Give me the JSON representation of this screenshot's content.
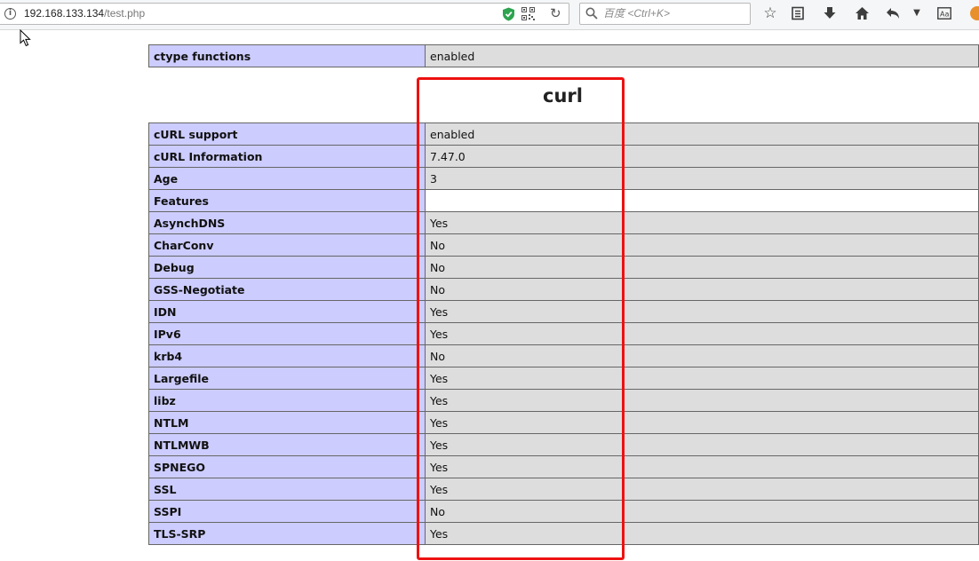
{
  "browser": {
    "url_host": "192.168.133.134",
    "url_path": "/test.php",
    "search_placeholder": "百度 <Ctrl+K>",
    "icons": [
      "info-icon",
      "shield-icon",
      "qr-code-icon",
      "reload-icon",
      "search-icon",
      "bookmark-star-icon",
      "reader-list-icon",
      "download-icon",
      "home-icon",
      "back-icon",
      "menu-dropdown-icon",
      "reader-mode-icon",
      "avatar-icon"
    ]
  },
  "ctype": {
    "label": "ctype functions",
    "value": "enabled"
  },
  "curl": {
    "title": "curl",
    "rows": [
      {
        "label": "cURL support",
        "value": "enabled"
      },
      {
        "label": "cURL Information",
        "value": "7.47.0"
      },
      {
        "label": "Age",
        "value": "3"
      },
      {
        "label": "Features",
        "value": ""
      },
      {
        "label": "AsynchDNS",
        "value": "Yes"
      },
      {
        "label": "CharConv",
        "value": "No"
      },
      {
        "label": "Debug",
        "value": "No"
      },
      {
        "label": "GSS-Negotiate",
        "value": "No"
      },
      {
        "label": "IDN",
        "value": "Yes"
      },
      {
        "label": "IPv6",
        "value": "Yes"
      },
      {
        "label": "krb4",
        "value": "No"
      },
      {
        "label": "Largefile",
        "value": "Yes"
      },
      {
        "label": "libz",
        "value": "Yes"
      },
      {
        "label": "NTLM",
        "value": "Yes"
      },
      {
        "label": "NTLMWB",
        "value": "Yes"
      },
      {
        "label": "SPNEGO",
        "value": "Yes"
      },
      {
        "label": "SSL",
        "value": "Yes"
      },
      {
        "label": "SSPI",
        "value": "No"
      },
      {
        "label": "TLS-SRP",
        "value": "Yes"
      }
    ]
  },
  "colors": {
    "label_cell": "#ccccff",
    "value_cell": "#dddddd",
    "highlight": "#ee1111"
  }
}
